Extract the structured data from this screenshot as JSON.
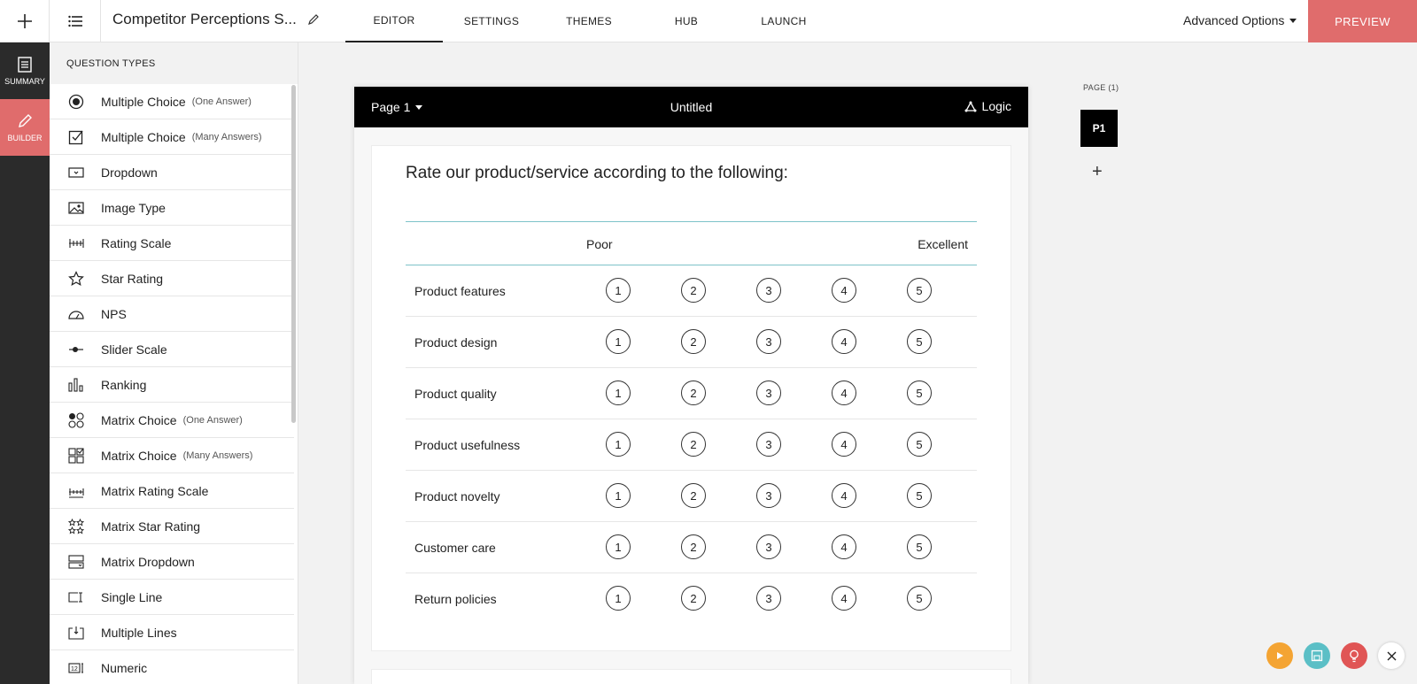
{
  "topbar": {
    "title": "Competitor Perceptions S...",
    "tabs": [
      {
        "label": "EDITOR",
        "active": true
      },
      {
        "label": "SETTINGS"
      },
      {
        "label": "THEMES"
      },
      {
        "label": "HUB"
      },
      {
        "label": "LAUNCH"
      }
    ],
    "advanced_label": "Advanced Options",
    "preview_label": "PREVIEW"
  },
  "rail": {
    "summary_label": "SUMMARY",
    "builder_label": "BUILDER"
  },
  "qpanel": {
    "header": "QUESTION TYPES",
    "items": [
      {
        "label": "Multiple Choice",
        "sub": "(One Answer)",
        "icon": "radio-icon"
      },
      {
        "label": "Multiple Choice",
        "sub": "(Many Answers)",
        "icon": "checkbox-icon"
      },
      {
        "label": "Dropdown",
        "sub": "",
        "icon": "dropdown-icon"
      },
      {
        "label": "Image Type",
        "sub": "",
        "icon": "image-icon"
      },
      {
        "label": "Rating Scale",
        "sub": "",
        "icon": "rating-scale-icon"
      },
      {
        "label": "Star Rating",
        "sub": "",
        "icon": "star-icon"
      },
      {
        "label": "NPS",
        "sub": "",
        "icon": "gauge-icon"
      },
      {
        "label": "Slider Scale",
        "sub": "",
        "icon": "slider-icon"
      },
      {
        "label": "Ranking",
        "sub": "",
        "icon": "ranking-icon"
      },
      {
        "label": "Matrix Choice",
        "sub": "(One Answer)",
        "icon": "matrix-radio-icon"
      },
      {
        "label": "Matrix Choice",
        "sub": "(Many Answers)",
        "icon": "matrix-checkbox-icon"
      },
      {
        "label": "Matrix Rating Scale",
        "sub": "",
        "icon": "matrix-rating-icon"
      },
      {
        "label": "Matrix Star Rating",
        "sub": "",
        "icon": "matrix-star-icon"
      },
      {
        "label": "Matrix Dropdown",
        "sub": "",
        "icon": "matrix-dropdown-icon"
      },
      {
        "label": "Single Line",
        "sub": "",
        "icon": "single-line-icon"
      },
      {
        "label": "Multiple Lines",
        "sub": "",
        "icon": "multi-line-icon"
      },
      {
        "label": "Numeric",
        "sub": "",
        "icon": "numeric-icon"
      }
    ]
  },
  "canvas": {
    "page_label": "Page 1",
    "page_title": "Untitled",
    "logic_label": "Logic",
    "question": "Rate our product/service according to the following:",
    "scale_low": "Poor",
    "scale_high": "Excellent",
    "options": [
      "1",
      "2",
      "3",
      "4",
      "5"
    ],
    "rows": [
      "Product features",
      "Product design",
      "Product quality",
      "Product usefulness",
      "Product novelty",
      "Customer care",
      "Return policies"
    ]
  },
  "pages": {
    "label": "PAGE (1)",
    "current": "P1",
    "add": "+"
  },
  "colors": {
    "accent": "#e06c6c",
    "teal": "#5bbfc6",
    "orange": "#f4a433",
    "red": "#e05555"
  }
}
